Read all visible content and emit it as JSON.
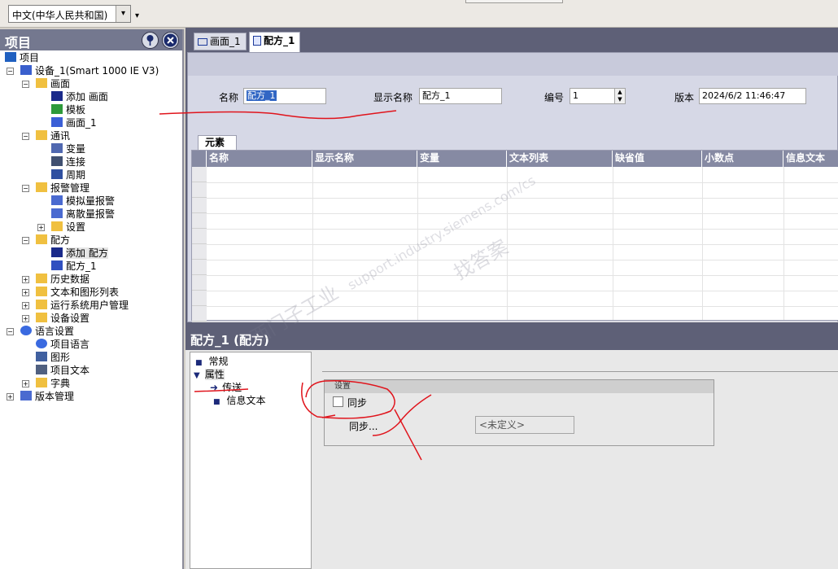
{
  "toolbar": {
    "language": "中文(中华人民共和国)",
    "dropdown_arrow": "▾",
    "more": "▾"
  },
  "project": {
    "title": "项目",
    "pin_icon": "pin-icon",
    "close_icon": "close-icon",
    "tree": [
      {
        "label": "项目",
        "level": 0,
        "icon": "project-icon",
        "expander": ""
      },
      {
        "label": "设备_1(Smart 1000 IE V3)",
        "level": 1,
        "icon": "device-icon",
        "expander": "−"
      },
      {
        "label": "画面",
        "level": 2,
        "icon": "folder-icon",
        "expander": "−"
      },
      {
        "label": "添加 画面",
        "level": 3,
        "icon": "add-arrow-icon",
        "expander": ""
      },
      {
        "label": "模板",
        "level": 3,
        "icon": "template-icon",
        "expander": ""
      },
      {
        "label": "画面_1",
        "level": 3,
        "icon": "screen-icon",
        "expander": ""
      },
      {
        "label": "通讯",
        "level": 2,
        "icon": "folder-icon",
        "expander": "−"
      },
      {
        "label": "变量",
        "level": 3,
        "icon": "tag-icon",
        "expander": ""
      },
      {
        "label": "连接",
        "level": 3,
        "icon": "connection-icon",
        "expander": ""
      },
      {
        "label": "周期",
        "level": 3,
        "icon": "cycle-icon",
        "expander": ""
      },
      {
        "label": "报警管理",
        "level": 2,
        "icon": "folder-icon",
        "expander": "−"
      },
      {
        "label": "模拟量报警",
        "level": 3,
        "icon": "analog-alarm-icon",
        "expander": ""
      },
      {
        "label": "离散量报警",
        "level": 3,
        "icon": "discrete-alarm-icon",
        "expander": ""
      },
      {
        "label": "设置",
        "level": 3,
        "icon": "settings-folder-icon",
        "expander": "+"
      },
      {
        "label": "配方",
        "level": 2,
        "icon": "folder-icon",
        "expander": "−"
      },
      {
        "label": "添加 配方",
        "level": 3,
        "icon": "add-arrow-icon",
        "expander": ""
      },
      {
        "label": "配方_1",
        "level": 3,
        "icon": "recipe-icon",
        "expander": ""
      },
      {
        "label": "历史数据",
        "level": 2,
        "icon": "folder-icon",
        "expander": "+"
      },
      {
        "label": "文本和图形列表",
        "level": 2,
        "icon": "folder-icon",
        "expander": "+"
      },
      {
        "label": "运行系统用户管理",
        "level": 2,
        "icon": "folder-icon",
        "expander": "+"
      },
      {
        "label": "设备设置",
        "level": 2,
        "icon": "folder-icon",
        "expander": "+"
      },
      {
        "label": "语言设置",
        "level": 1,
        "icon": "globe-icon",
        "expander": "−"
      },
      {
        "label": "项目语言",
        "level": 2,
        "icon": "globe-icon",
        "expander": ""
      },
      {
        "label": "图形",
        "level": 2,
        "icon": "graphic-icon",
        "expander": ""
      },
      {
        "label": "项目文本",
        "level": 2,
        "icon": "text-icon",
        "expander": ""
      },
      {
        "label": "字典",
        "level": 2,
        "icon": "folder-icon",
        "expander": "+"
      },
      {
        "label": "版本管理",
        "level": 1,
        "icon": "version-icon",
        "expander": "+"
      }
    ]
  },
  "editor": {
    "tabs": [
      {
        "label": "画面_1",
        "active": false
      },
      {
        "label": "配方_1",
        "active": true
      }
    ],
    "fields": {
      "name_label": "名称",
      "name_value": "配方_1",
      "display_name_label": "显示名称",
      "display_name_value": "配方_1",
      "number_label": "编号",
      "number_value": "1",
      "version_label": "版本",
      "version_value": "2024/6/2 11:46:47"
    },
    "elements_tab": "元素",
    "columns": [
      "名称",
      "显示名称",
      "变量",
      "文本列表",
      "缺省值",
      "小数点",
      "信息文本"
    ]
  },
  "properties": {
    "title": "配方_1 (配方)",
    "nav": [
      {
        "label": "常规",
        "marker": "■"
      },
      {
        "label": "属性",
        "marker": "▼"
      },
      {
        "label": "传送",
        "marker": "➜"
      },
      {
        "label": "信息文本",
        "marker": "■"
      }
    ],
    "group_title": "设置",
    "sync_checkbox_label": "同步",
    "sync_label": "同步...",
    "sync_value": "<未定义>"
  },
  "watermark": {
    "line1": "西门子工业",
    "line2": "support.industry.siemens.com/cs",
    "line3": "找答案"
  },
  "colors": {
    "panel_header": "#74788f",
    "grid_header": "#868aa3",
    "annotation": "#e0141c"
  }
}
